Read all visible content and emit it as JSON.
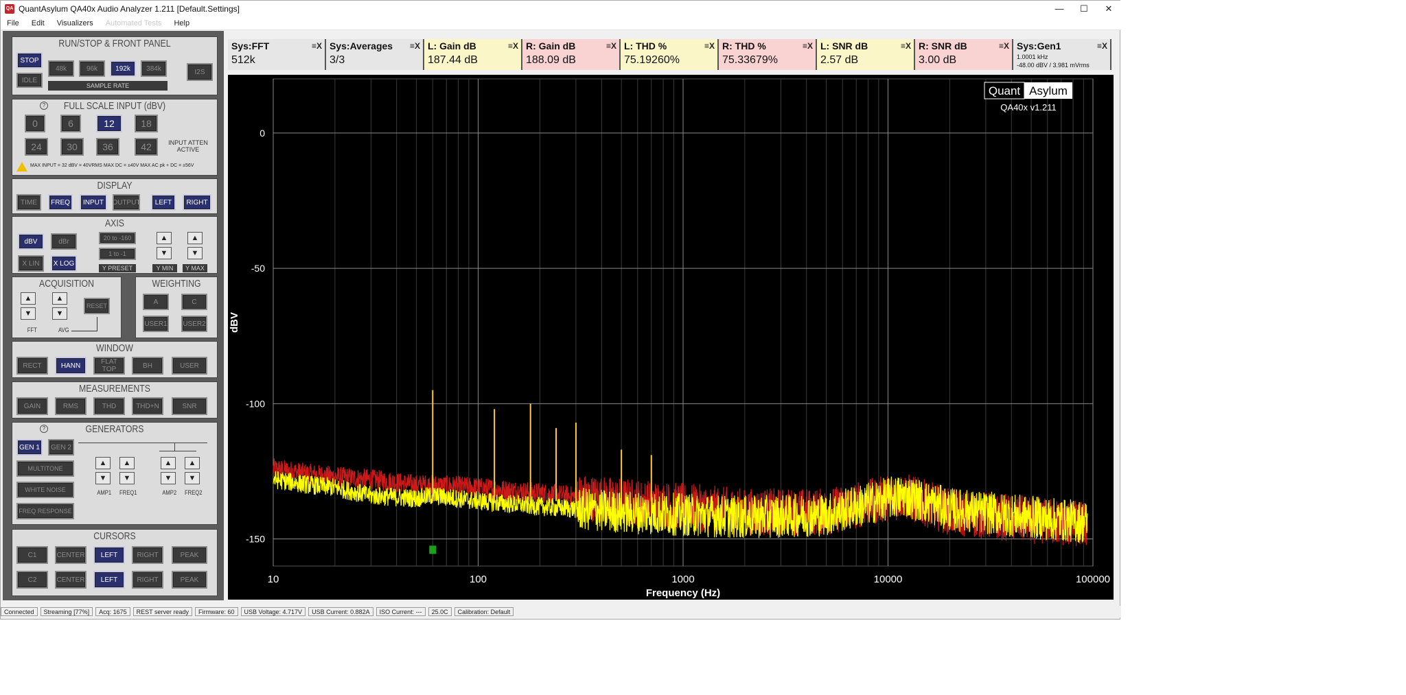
{
  "window": {
    "title": "QuantAsylum QA40x Audio Analyzer 1.211 [Default.Settings]",
    "minimize": "—",
    "maximize": "☐",
    "close": "✕"
  },
  "menu": [
    "File",
    "Edit",
    "Visualizers",
    "Automated Tests",
    "Help"
  ],
  "panel": {
    "runstop": {
      "title": "RUN/STOP & FRONT PANEL",
      "stop": "STOP",
      "idle": "IDLE",
      "rates": [
        "48k",
        "96k",
        "192k",
        "384k"
      ],
      "i2s": "I2S",
      "sample_rate": "SAMPLE RATE"
    },
    "fsi": {
      "title": "FULL SCALE INPUT (dBV)",
      "row1": [
        "0",
        "6",
        "12",
        "18"
      ],
      "row2": [
        "24",
        "30",
        "36",
        "42"
      ],
      "atten": "INPUT ATTEN ACTIVE",
      "warning": "MAX INPUT = 32 dBV = 40VRMS    MAX DC = ±40V    MAX AC pk + DC = ±56V"
    },
    "display": {
      "title": "DISPLAY",
      "buttons": [
        "TIME",
        "FREQ",
        "INPUT",
        "OUTPUT",
        "LEFT",
        "RIGHT"
      ]
    },
    "axis": {
      "title": "AXIS",
      "dbv": "dBV",
      "dbr": "dBr",
      "xlin": "X LIN",
      "xlog": "X LOG",
      "preset1": "20 to -160",
      "preset2": "1 to -1",
      "ypreset": "Y PRESET",
      "ymin": "Y MIN",
      "ymax": "Y MAX"
    },
    "acquisition": {
      "title": "ACQUISITION",
      "reset": "RESET",
      "fft": "FFT",
      "avg": "AVG"
    },
    "weighting": {
      "title": "WEIGHTING",
      "buttons": [
        "A",
        "C",
        "USER1",
        "USER2"
      ]
    },
    "window": {
      "title": "WINDOW",
      "buttons": [
        "RECT",
        "HANN",
        "FLAT TOP",
        "BH",
        "USER"
      ]
    },
    "measurements": {
      "title": "MEASUREMENTS",
      "buttons": [
        "GAIN",
        "RMS",
        "THD",
        "THD+N",
        "SNR"
      ]
    },
    "generators": {
      "title": "GENERATORS",
      "gen1": "GEN 1",
      "gen2": "GEN 2",
      "multitone": "MULTITONE",
      "white": "WHITE NOISE",
      "freqresp": "FREQ RESPONSE",
      "amp1": "AMP1",
      "freq1": "FREQ1",
      "amp2": "AMP2",
      "freq2": "FREQ2"
    },
    "cursors": {
      "title": "CURSORS",
      "row1": [
        "C1",
        "CENTER",
        "LEFT",
        "RIGHT",
        "PEAK"
      ],
      "row2": [
        "C2",
        "CENTER",
        "LEFT",
        "RIGHT",
        "PEAK"
      ]
    }
  },
  "measurements": [
    {
      "label": "Sys:FFT",
      "value": "512k",
      "bg": "#e6e6e6"
    },
    {
      "label": "Sys:Averages",
      "value": "3/3",
      "bg": "#e6e6e6"
    },
    {
      "label": "L: Gain dB",
      "value": "187.44 dB",
      "bg": "#fbf6c8"
    },
    {
      "label": "R: Gain dB",
      "value": "188.09 dB",
      "bg": "#f9d2d2"
    },
    {
      "label": "L: THD %",
      "value": "75.19260%",
      "bg": "#fbf6c8"
    },
    {
      "label": "R: THD %",
      "value": "75.33679%",
      "bg": "#f9d2d2"
    },
    {
      "label": "L: SNR dB",
      "value": "2.57 dB",
      "bg": "#fbf6c8"
    },
    {
      "label": "R: SNR dB",
      "value": "3.00 dB",
      "bg": "#f9d2d2"
    },
    {
      "label": "Sys:Gen1",
      "sub1": "1.0001 kHz",
      "sub2": "-48.00 dBV  / 3.981 mVrms",
      "bg": "#e6e6e6"
    }
  ],
  "measure_controls": "≡X",
  "chart_data": {
    "type": "line",
    "xlabel": "Frequency (Hz)",
    "ylabel": "dBV",
    "xscale": "log",
    "xlim": [
      10,
      100000
    ],
    "ylim": [
      -160,
      20
    ],
    "xticks": [
      "10",
      "100",
      "1000",
      "10000",
      "100000"
    ],
    "yticks": [
      "0",
      "-50",
      "-100",
      "-150"
    ],
    "grid": true,
    "brand_left": "Quant",
    "brand_right": "Asylum",
    "version": "QA40x v1.211",
    "series": [
      {
        "color": "#cc1a1a",
        "x": [
          10,
          15,
          20,
          30,
          50,
          60,
          100,
          200,
          500,
          1000,
          2000,
          5000,
          10000,
          12000,
          20000,
          50000,
          100000
        ],
        "y": [
          -124,
          -126,
          -127,
          -128,
          -130,
          -130,
          -131,
          -133,
          -136,
          -138,
          -140,
          -140,
          -135,
          -134,
          -140,
          -143,
          -145
        ]
      },
      {
        "color": "#ffff00",
        "x": [
          10,
          15,
          20,
          30,
          50,
          60,
          100,
          200,
          500,
          1000,
          2000,
          5000,
          10000,
          12000,
          20000,
          50000,
          100000
        ],
        "y": [
          -128,
          -130,
          -131,
          -134,
          -135,
          -134,
          -136,
          -138,
          -140,
          -141,
          -142,
          -141,
          -135,
          -134,
          -139,
          -142,
          -144
        ]
      }
    ],
    "harmonics": [
      {
        "x": 60,
        "y": -95
      },
      {
        "x": 120,
        "y": -102
      },
      {
        "x": 180,
        "y": -100
      },
      {
        "x": 240,
        "y": -109
      },
      {
        "x": 300,
        "y": -107
      },
      {
        "x": 500,
        "y": -117
      },
      {
        "x": 700,
        "y": -119
      }
    ],
    "marker": {
      "x": 60,
      "y": -154,
      "color": "#1aa01a"
    }
  },
  "status": [
    "Connected",
    "Streaming [77%]",
    "Acq: 1675",
    "REST server ready",
    "Firmware: 60",
    "USB Voltage: 4.717V",
    "USB Current: 0.882A",
    "ISO Current: ---",
    "25.0C",
    "Calibration: Default"
  ]
}
